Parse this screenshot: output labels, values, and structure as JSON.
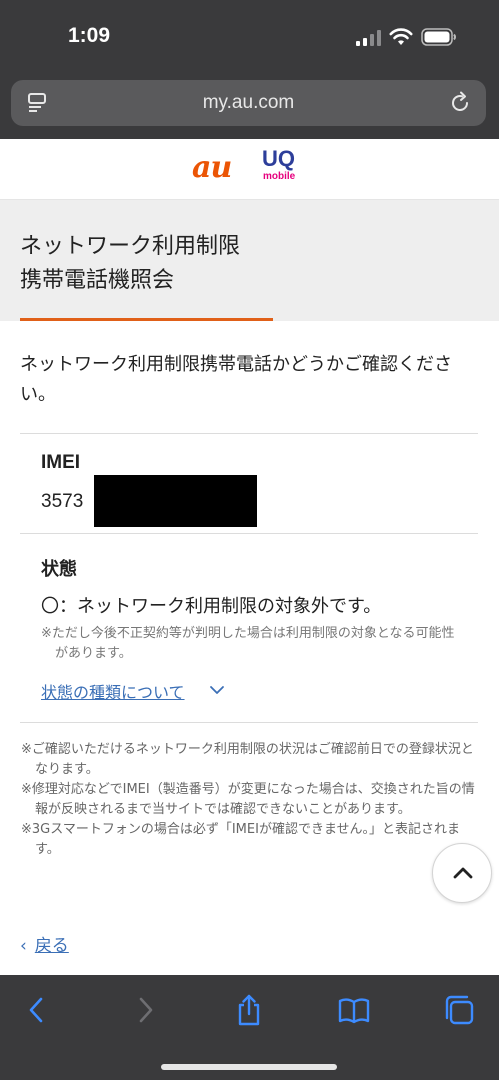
{
  "status_bar": {
    "time": "1:09"
  },
  "browser": {
    "url": "my.au.com"
  },
  "logos": {
    "au": "au",
    "uq": "UQ",
    "uq_sub": "mobile"
  },
  "page": {
    "title_line1": "ネットワーク利用制限",
    "title_line2": "携帯電話機照会",
    "intro": "ネットワーク利用制限携帯電話かどうかご確認ください。",
    "imei_label": "IMEI",
    "imei_value": "3573",
    "state_label": "状態",
    "state_value": "〇：ネットワーク利用制限の対象外です。",
    "state_note": "※ただし今後不正契約等が判明した場合は利用制限の対象となる可能性があります。",
    "state_link": "状態の種類について",
    "footnotes": [
      "※ご確認いただけるネットワーク利用制限の状況はご確認前日での登録状況となります。",
      "※修理対応などでIMEI（製造番号）が変更になった場合は、交換された旨の情報が反映されるまで当サイトでは確認できないことがあります。",
      "※3Gスマートフォンの場合は必ず「IMEIが確認できません。」と表記されます。"
    ],
    "back_label": "戻る"
  },
  "colors": {
    "accent_orange": "#e06018",
    "link_blue": "#3b6fb6",
    "au_orange": "#eb5505",
    "uq_blue": "#2d3e9a",
    "uq_pink": "#e6007e"
  },
  "icons": {
    "status": [
      "signal-icon",
      "wifi-icon",
      "battery-icon"
    ],
    "toolbar": [
      "back-icon",
      "forward-icon",
      "share-icon",
      "bookmarks-icon",
      "tabs-icon"
    ]
  }
}
